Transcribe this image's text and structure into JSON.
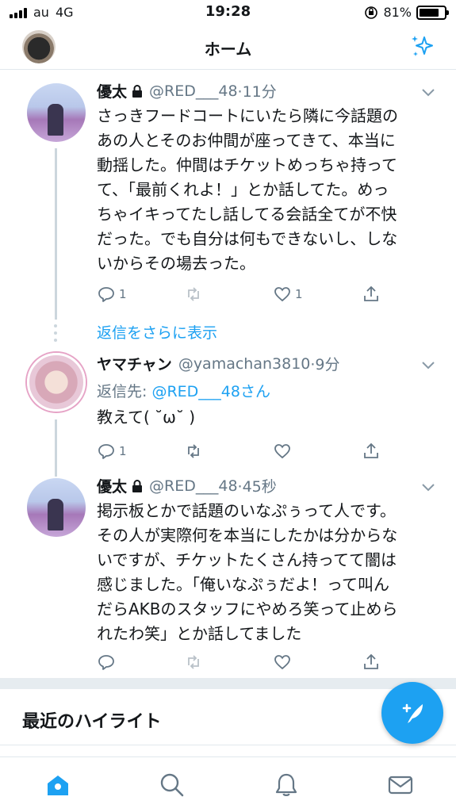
{
  "status_bar": {
    "carrier": "au",
    "network": "4G",
    "time": "19:28",
    "battery": "81%",
    "battery_fraction": 0.81
  },
  "nav": {
    "title": "ホーム",
    "left_icon": "profile-avatar",
    "right_icon": "sparkle-icon"
  },
  "tweets": [
    {
      "name": "優太",
      "handle": "@RED___48",
      "time": "·11分",
      "protected": true,
      "text": "さっきフードコートにいたら隣に今話題の\nあの人とそのお仲間が座ってきて、本当に\n動揺した。仲間はチケットめっちゃ持って\nて、「最前くれよ！」とか話してた。めっ\nちゃイキってたし話してる会話全てが不快\nだった。でも自分は何もできないし、しな\nいからその場去った。",
      "replies": "1",
      "retweets": "",
      "likes": "1"
    },
    {
      "name": "ヤマチャン",
      "handle": "@yamachan3810",
      "time": "·9分",
      "protected": false,
      "reply_prefix": "返信先: ",
      "reply_mention": "@RED___48さん",
      "text": "教えて( ˘ω˘ )",
      "replies": "1",
      "retweets": "",
      "likes": ""
    },
    {
      "name": "優太",
      "handle": "@RED___48",
      "time": "·45秒",
      "protected": true,
      "text": "掲示板とかで話題のいなぷぅって人です。\nその人が実際何を本当にしたかは分からな\nいですが、チケットたくさん持ってて闇は\n感じました。「俺いなぷぅだよ！って叫ん\nだらAKBのスタッフにやめろ笑って止めら\nれたわ笑」とか話してました",
      "replies": "",
      "retweets": "",
      "likes": ""
    }
  ],
  "show_more_replies": "返信をさらに表示",
  "highlights": {
    "title": "最近のハイライト"
  },
  "compose_button": {
    "icon": "compose-feather-icon"
  },
  "tab_bar": {
    "tabs": [
      "home-icon",
      "search-icon",
      "notifications-icon",
      "messages-icon"
    ],
    "active": "home-icon"
  },
  "colors": {
    "accent": "#1da1f2",
    "secondary_text": "#657786",
    "divider": "#e6ecf0"
  }
}
